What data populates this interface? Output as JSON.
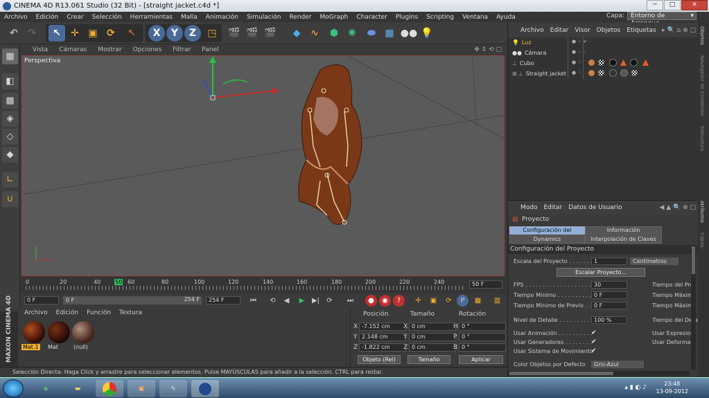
{
  "window": {
    "title": "CINEMA 4D R13.061 Studio (32 Bit) - [straight jacket.c4d *]",
    "min": "─",
    "max": "□",
    "close": "✕"
  },
  "menu": [
    "Archivo",
    "Edición",
    "Crear",
    "Selección",
    "Herramientas",
    "Malla",
    "Animación",
    "Simulación",
    "Render",
    "MoGraph",
    "Character",
    "Plugins",
    "Scripting",
    "Ventana",
    "Ayuda"
  ],
  "layer": {
    "label": "Capa:",
    "value": "Entorno de Arranque"
  },
  "toolbar": {
    "icons": [
      "undo-icon",
      "redo-icon",
      "select-live-icon",
      "move-icon",
      "scale-icon",
      "rotate-icon",
      "recent-tool-icon",
      "x-axis-icon",
      "y-axis-icon",
      "z-axis-icon",
      "coordinate-system-icon",
      "render-view-icon",
      "render-picture-viewer-icon",
      "render-settings-icon",
      "cube-primitive-icon",
      "spline-icon",
      "nurbs-icon",
      "array-icon",
      "deformer-icon",
      "floor-icon",
      "camera-icon",
      "light-icon"
    ],
    "x": "X",
    "y": "Y",
    "z": "Z"
  },
  "viewport": {
    "menu": [
      "Vista",
      "Cámaras",
      "Mostrar",
      "Opciones",
      "Filtrar",
      "Panel"
    ],
    "label": "Perspectiva"
  },
  "timeline": {
    "ticks": [
      "0",
      "20",
      "40",
      "50",
      "60",
      "80",
      "100",
      "120",
      "140",
      "160",
      "180",
      "200",
      "220",
      "240"
    ],
    "current": "50",
    "end_field": "50 F"
  },
  "playback": {
    "start": "0 F",
    "range_start": "0 F",
    "range_end": "254 F",
    "end": "254 F"
  },
  "materials": {
    "menu": [
      "Archivo",
      "Edición",
      "Función",
      "Textura"
    ],
    "items": [
      {
        "name": "Mat.1",
        "color": "#5a1a10"
      },
      {
        "name": "Mat",
        "color": "#3a1a10"
      },
      {
        "name": "(null)",
        "color": "#8a6a5a"
      }
    ]
  },
  "maxon": "MAXON CINEMA 4D",
  "coords": {
    "headers": [
      "Posición",
      "Tamaño",
      "Rotación"
    ],
    "rows": [
      {
        "axis": "X",
        "pos": "-7.152 cm",
        "s_axis": "X",
        "size": "0 cm",
        "r_axis": "H",
        "rot": "0 °"
      },
      {
        "axis": "Y",
        "pos": "2.148 cm",
        "s_axis": "Y",
        "size": "0 cm",
        "r_axis": "P",
        "rot": "0 °"
      },
      {
        "axis": "Z",
        "pos": "-1.822 cm",
        "s_axis": "Z",
        "size": "0 cm",
        "r_axis": "B",
        "rot": "0 °"
      }
    ],
    "mode1": "Objeto (Rel)",
    "mode2": "Tamaño",
    "apply": "Aplicar"
  },
  "status": "Selección Directa: Haga Click y arrastre para seleccionar elementos. Pulse MAYÚSCULAS para añadir a la selección. CTRL para restar.",
  "objects": {
    "menu": [
      "Archivo",
      "Editar",
      "Visor",
      "Objetos",
      "Etiquetas"
    ],
    "items": [
      {
        "name": "Luz",
        "color": "#e8c040"
      },
      {
        "name": "Cámara",
        "color": "#dddddd"
      },
      {
        "name": "Cubo",
        "color": "#dddddd"
      },
      {
        "name": "Straight jacket",
        "color": "#dddddd"
      }
    ]
  },
  "attributes": {
    "menu": [
      "Modo",
      "Editar",
      "Datos de Usuario"
    ],
    "title": "Proyecto",
    "tabs": [
      "Configuración del Proyecto",
      "Información",
      "Dynamics",
      "Interpolación de Claves"
    ],
    "section": "Configuración del Proyecto",
    "rows": [
      {
        "label": "Escala del Proyecto . . . . . . .",
        "value": "1",
        "extra": "Centímetros"
      },
      {
        "label": "FPS . . . . . . . . . . . . . . . . . . .",
        "value": "30",
        "right": "Tiempo del Pro"
      },
      {
        "label": "Tiempo Mínimo . . . . . . . . . . .",
        "value": "0 F",
        "right": "Tiempo Máxim"
      },
      {
        "label": "Tiempo Mínimo de Previo . .",
        "value": "0 F",
        "right": "Tiempo Máxim"
      },
      {
        "label": "Nivel de Detalle . . . . . . . . .",
        "value": "100 %",
        "right": "Tiempo del Detal"
      }
    ],
    "scale_button": "Escalar Proyecto...",
    "checks": [
      {
        "label": "Usar Animación . . . . . . . . . .",
        "right": "Usar Expresior"
      },
      {
        "label": "Usar Generadores . . . . . . . .",
        "right": "Usar Deformad"
      },
      {
        "label": "Usar Sistema de Movimiento"
      }
    ],
    "color_label": "Color Objetos por Defecto",
    "color_value": "Gris-Azul",
    "check_mark": "✔"
  },
  "right_tabs": [
    "Objetos",
    "Navegador de Contenido",
    "Estructura",
    "Atributos",
    "Capas"
  ],
  "taskbar": {
    "time": "23:48",
    "date": "13-09-2012"
  }
}
